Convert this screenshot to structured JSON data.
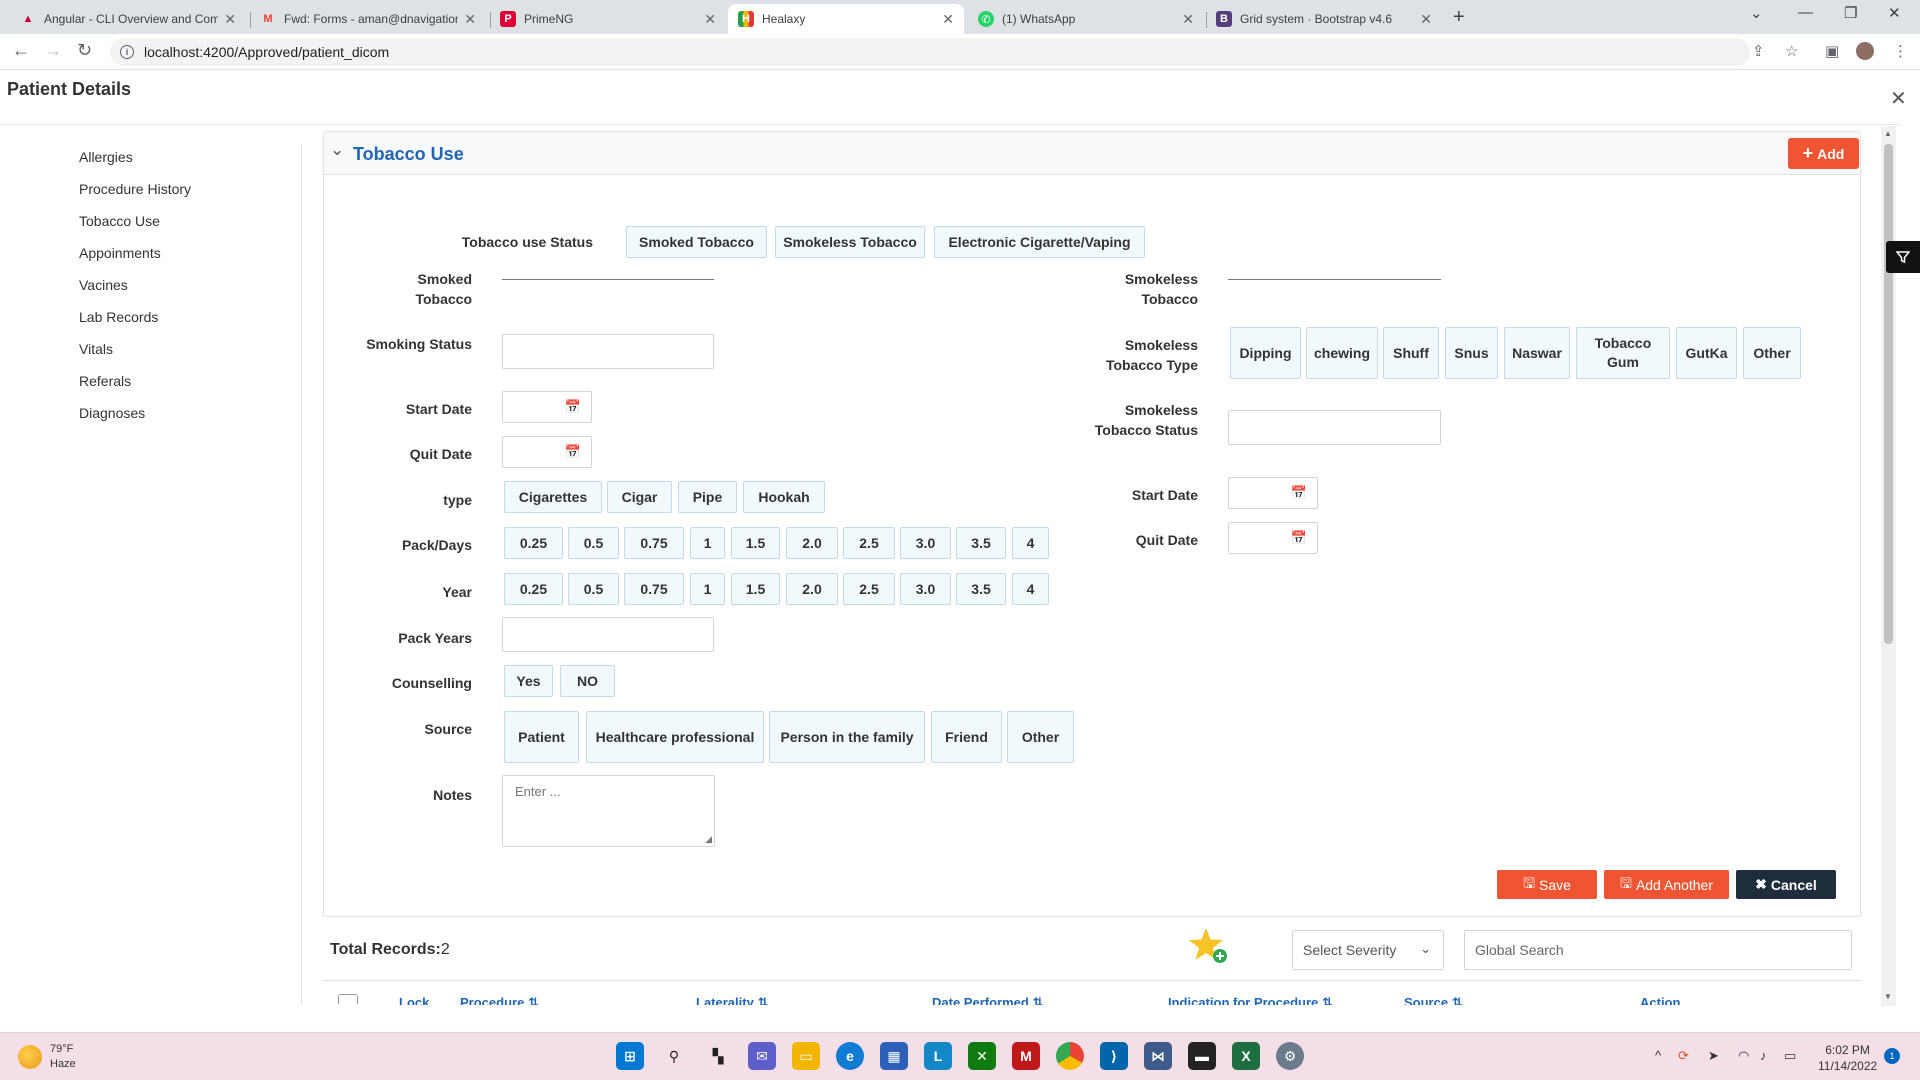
{
  "browser": {
    "tabs": [
      {
        "title": "Angular - CLI Overview and Com",
        "favicon": "angular-icon",
        "color": "#c3002f",
        "glyph": "A"
      },
      {
        "title": "Fwd: Forms - aman@dnavigation",
        "favicon": "gmail-icon",
        "color": "#ea4335",
        "glyph": "M"
      },
      {
        "title": "PrimeNG",
        "favicon": "primeng-icon",
        "color": "#dd0031",
        "glyph": "P"
      },
      {
        "title": "Healaxy",
        "favicon": "healaxy-icon",
        "color": "#2a9d4b",
        "glyph": "H"
      },
      {
        "title": "(1) WhatsApp",
        "favicon": "whatsapp-icon",
        "color": "#25d366",
        "glyph": "W"
      },
      {
        "title": "Grid system · Bootstrap v4.6",
        "favicon": "bootstrap-icon",
        "color": "#563d7c",
        "glyph": "B"
      }
    ],
    "active_tab": 3,
    "url": "localhost:4200/Approved/patient_dicom"
  },
  "page": {
    "title": "Patient Details"
  },
  "sidebar": {
    "items": [
      "Allergies",
      "Procedure History",
      "Tobacco Use",
      "Appoinments",
      "Vacines",
      "Lab Records",
      "Vitals",
      "Referals",
      "Diagnoses"
    ]
  },
  "panel": {
    "title": "Tobacco Use",
    "add_label": "Add"
  },
  "form": {
    "status_label": "Tobacco use Status",
    "status_options": [
      "Smoked Tobacco",
      "Smokeless Tobacco",
      "Electronic Cigarette/Vaping"
    ],
    "left": {
      "smoked_tobacco_label": "Smoked Tobacco",
      "smoking_status_label": "Smoking Status",
      "start_date_label": "Start Date",
      "quit_date_label": "Quit Date",
      "type_label": "type",
      "type_options": [
        "Cigarettes",
        "Cigar",
        "Pipe",
        "Hookah"
      ],
      "pack_days_label": "Pack/Days",
      "pack_days_options": [
        "0.25",
        "0.5",
        "0.75",
        "1",
        "1.5",
        "2.0",
        "2.5",
        "3.0",
        "3.5",
        "4"
      ],
      "year_label": "Year",
      "year_options": [
        "0.25",
        "0.5",
        "0.75",
        "1",
        "1.5",
        "2.0",
        "2.5",
        "3.0",
        "3.5",
        "4"
      ],
      "pack_years_label": "Pack Years",
      "counselling_label": "Counselling",
      "counselling_options": [
        "Yes",
        "NO"
      ],
      "source_label": "Source",
      "source_options": [
        "Patient",
        "Healthcare professional",
        "Person in the family",
        "Friend",
        "Other"
      ],
      "notes_label": "Notes",
      "notes_placeholder": "Enter ..."
    },
    "right": {
      "smokeless_tobacco_label": "Smokeless Tobacco",
      "smokeless_type_label": "Smokeless Tobacco Type",
      "smokeless_type_options": [
        "Dipping",
        "chewing",
        "Shuff",
        "Snus",
        "Naswar",
        "Tobacco Gum",
        "GutKa",
        "Other"
      ],
      "smokeless_status_label": "Smokeless Tobacco Status",
      "start_date_label": "Start Date",
      "quit_date_label": "Quit Date"
    },
    "actions": {
      "save": "Save",
      "add_another": "Add Another",
      "cancel": "Cancel"
    }
  },
  "records": {
    "label": "Total Records:",
    "count": "2",
    "severity_placeholder": "Select Severity",
    "search_placeholder": "Global Search",
    "columns": [
      "Lock",
      "Procedure",
      "Laterality",
      "Date Performed",
      "Indication for Procedure",
      "Source",
      "Action"
    ]
  },
  "taskbar": {
    "temperature": "79°F",
    "condition": "Haze",
    "time": "6:02 PM",
    "date": "11/14/2022",
    "notifications": "1"
  },
  "colors": {
    "accent_red": "#ef5532",
    "heading_blue": "#2166b5",
    "chip_bg": "#f1f9fd",
    "dark_button": "#1f2c3b"
  }
}
